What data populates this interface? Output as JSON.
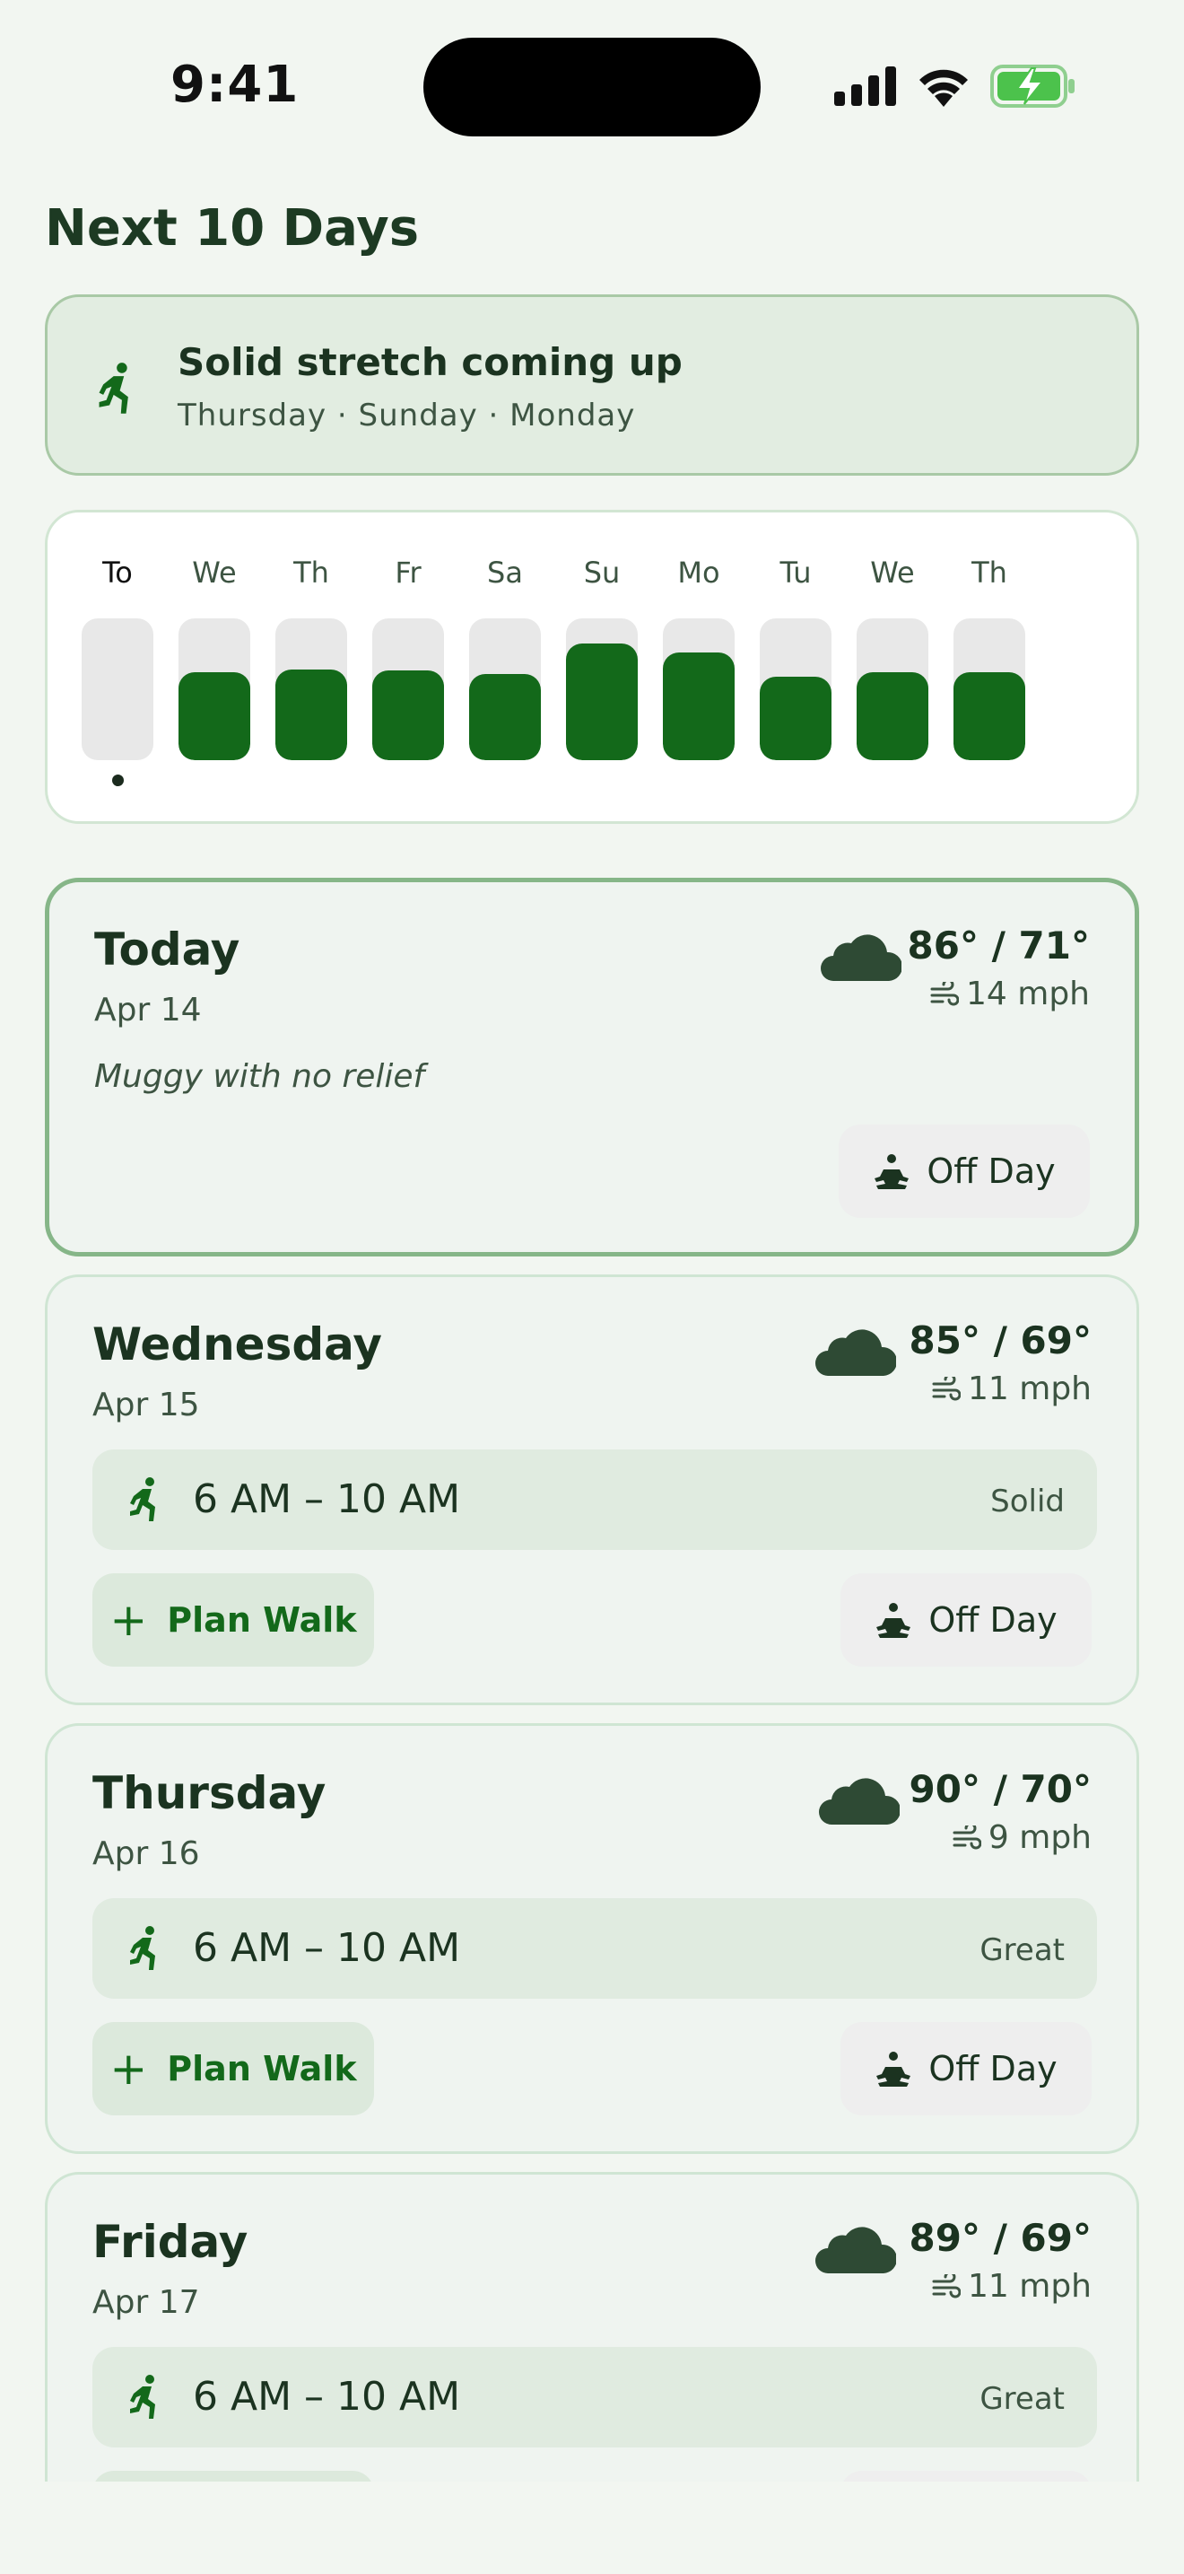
{
  "status": {
    "time": "9:41"
  },
  "page_title": "Next 10 Days",
  "banner": {
    "title": "Solid stretch coming up",
    "subtitle": "Thursday · Sunday · Monday",
    "icon": "runner-icon"
  },
  "strip": {
    "days": [
      {
        "label": "To",
        "score": 0,
        "today": true
      },
      {
        "label": "We",
        "score": 0.62
      },
      {
        "label": "Th",
        "score": 0.64
      },
      {
        "label": "Fr",
        "score": 0.63
      },
      {
        "label": "Sa",
        "score": 0.61
      },
      {
        "label": "Su",
        "score": 0.82
      },
      {
        "label": "Mo",
        "score": 0.76
      },
      {
        "label": "Tu",
        "score": 0.59
      },
      {
        "label": "We",
        "score": 0.62
      },
      {
        "label": "Th",
        "score": 0.62
      }
    ],
    "accent_color": "#13691a"
  },
  "cards": [
    {
      "day": "Today",
      "date": "Apr 14",
      "temp": "86° / 71°",
      "wind": "14 mph",
      "note": "Muggy with no relief",
      "off_label": "Off Day"
    },
    {
      "day": "Wednesday",
      "date": "Apr 15",
      "temp": "85° / 69°",
      "wind": "11 mph",
      "window": "6 AM – 10 AM",
      "quality": "Solid",
      "plan_label": "Plan Walk",
      "off_label": "Off Day"
    },
    {
      "day": "Thursday",
      "date": "Apr 16",
      "temp": "90° / 70°",
      "wind": "9 mph",
      "window": "6 AM – 10 AM",
      "quality": "Great",
      "plan_label": "Plan Walk",
      "off_label": "Off Day"
    },
    {
      "day": "Friday",
      "date": "Apr 17",
      "temp": "89° / 69°",
      "wind": "11 mph",
      "window": "6 AM – 10 AM",
      "quality": "Great"
    }
  ]
}
